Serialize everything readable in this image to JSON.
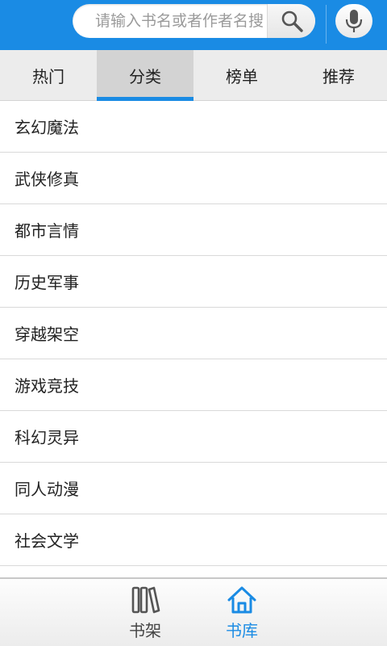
{
  "search": {
    "placeholder": "请输入书名或者作者名搜",
    "search_icon": "search-icon",
    "voice_icon": "microphone-icon"
  },
  "tabs": [
    {
      "label": "热门",
      "active": false
    },
    {
      "label": "分类",
      "active": true
    },
    {
      "label": "榜单",
      "active": false
    },
    {
      "label": "推荐",
      "active": false
    }
  ],
  "categories": [
    "玄幻魔法",
    "武侠修真",
    "都市言情",
    "历史军事",
    "穿越架空",
    "游戏竞技",
    "科幻灵异",
    "同人动漫",
    "社会文学"
  ],
  "bottom_nav": {
    "shelf_label": "书架",
    "library_label": "书库",
    "shelf_icon": "bookshelf-icon",
    "library_icon": "home-icon",
    "active": "library"
  },
  "colors": {
    "header": "#1a8be4",
    "active_tab_indicator": "#1a8be4",
    "active_nav_text": "#1a8be4"
  }
}
